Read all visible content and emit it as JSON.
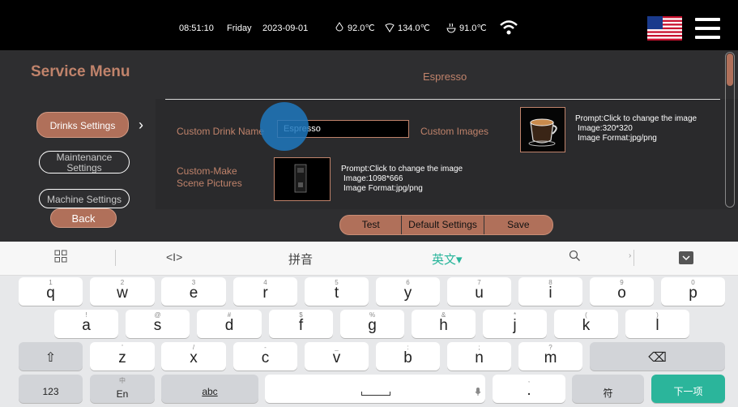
{
  "status": {
    "time": "08:51:10",
    "day": "Friday",
    "date": "2023-09-01",
    "temps": [
      "92.0℃",
      "134.0℃",
      "91.0℃"
    ],
    "icons": [
      "water-drop-icon",
      "steam-icon",
      "cup-icon",
      "wifi-icon",
      "us-flag-icon",
      "hamburger-menu-icon"
    ]
  },
  "sidebar": {
    "title": "Service Menu",
    "items": [
      {
        "label": "Drinks Settings",
        "active": true
      },
      {
        "label": "Maintenance Settings",
        "active": false
      },
      {
        "label": "Machine Settings",
        "active": false
      }
    ],
    "back_label": "Back"
  },
  "main": {
    "title": "Espresso",
    "custom_name_label": "Custom Drink Name",
    "custom_name_value": "Espresso",
    "custom_images_label": "Custom Images",
    "image_prompt": [
      "Prompt:Click to change the image",
      "Image:320*320",
      "Image Format:jpg/png"
    ],
    "scene_label": [
      "Custom-Make",
      "Scene Pictures"
    ],
    "scene_prompt": [
      "Prompt:Click to change the image",
      "Image:1098*666",
      "Image Format:jpg/png"
    ],
    "buttons": {
      "test": "Test",
      "default": "Default Settings",
      "save": "Save"
    }
  },
  "keyboard": {
    "candidates": {
      "cursor": "<I>",
      "pinyin": "拼音",
      "english": "英文▾"
    },
    "row1": [
      {
        "key": "q",
        "sub": "1"
      },
      {
        "key": "w",
        "sub": "2"
      },
      {
        "key": "e",
        "sub": "3"
      },
      {
        "key": "r",
        "sub": "4"
      },
      {
        "key": "t",
        "sub": "5"
      },
      {
        "key": "y",
        "sub": "6"
      },
      {
        "key": "u",
        "sub": "7"
      },
      {
        "key": "i",
        "sub": "8"
      },
      {
        "key": "o",
        "sub": "9"
      },
      {
        "key": "p",
        "sub": "0"
      }
    ],
    "row2": [
      {
        "key": "a",
        "sub": "!"
      },
      {
        "key": "s",
        "sub": "@"
      },
      {
        "key": "d",
        "sub": "#"
      },
      {
        "key": "f",
        "sub": "$"
      },
      {
        "key": "g",
        "sub": "%"
      },
      {
        "key": "h",
        "sub": "&"
      },
      {
        "key": "j",
        "sub": "*"
      },
      {
        "key": "k",
        "sub": "("
      },
      {
        "key": "l",
        "sub": ")"
      }
    ],
    "row3": [
      {
        "key": "z",
        "sub": "'"
      },
      {
        "key": "x",
        "sub": "/"
      },
      {
        "key": "c",
        "sub": "-"
      },
      {
        "key": "v",
        "sub": "_"
      },
      {
        "key": "b",
        "sub": ":"
      },
      {
        "key": "n",
        "sub": ";"
      },
      {
        "key": "m",
        "sub": "?"
      }
    ],
    "shift": "⇧",
    "backspace": "⌫",
    "num": "123",
    "lang_sub": "中",
    "lang": "En",
    "abc": "abc",
    "dot": ".",
    "dot_sub": ",",
    "symbol": "符",
    "next": "下一项"
  }
}
